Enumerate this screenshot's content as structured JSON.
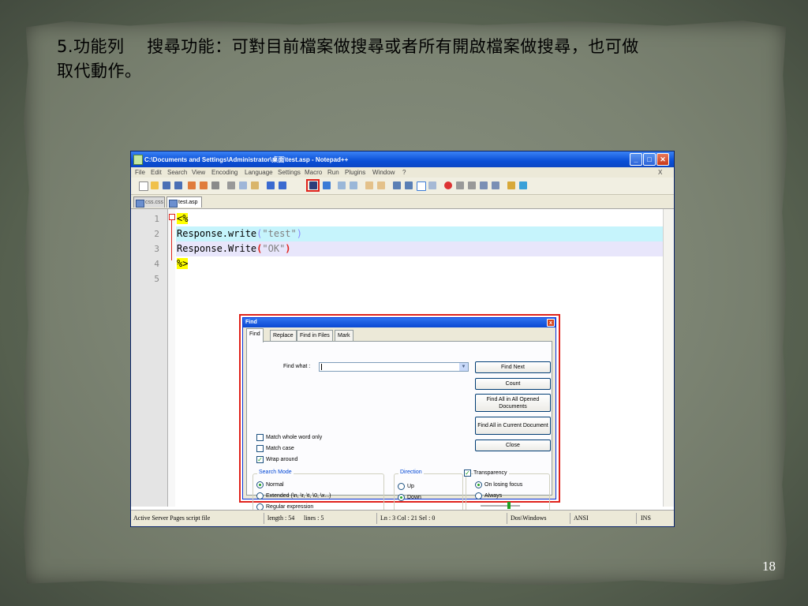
{
  "slide": {
    "title_line1": "5.功能列 　搜尋功能：可對目前檔案做搜尋或者所有開啟檔案做搜尋，也可做",
    "title_line2": "取代動作。",
    "page_number": "18"
  },
  "app": {
    "window_title": "C:\\Documents and Settings\\Administrator\\桌面\\test.asp - Notepad++",
    "menu": [
      "File",
      "Edit",
      "Search",
      "View",
      "Encoding",
      "Language",
      "Settings",
      "Macro",
      "Run",
      "Plugins",
      "Window",
      "?"
    ],
    "menu_close": "X",
    "tabs": [
      "css.css",
      "test.asp"
    ],
    "line_numbers": [
      "1",
      "2",
      "3",
      "4",
      "5"
    ],
    "code": {
      "l1": "<%",
      "l2_obj": "Response.write",
      "l2_paren_open": "(",
      "l2_str": "\"test\"",
      "l2_paren_close": ")",
      "l3_obj": "Response.Write",
      "l3_paren_open": "(",
      "l3_str": "\"OK\"",
      "l3_paren_close": ")",
      "l4": "%>"
    },
    "status": {
      "file_type": "Active Server Pages script file",
      "length": "length : 54",
      "lines": "lines : 5",
      "position": "Ln : 3    Col : 21    Sel : 0",
      "eol": "Dos\\Windows",
      "encoding": "ANSI",
      "mode": "INS"
    }
  },
  "find_dialog": {
    "title": "Find",
    "close": "x",
    "tabs": [
      "Find",
      "Replace",
      "Find in Files",
      "Mark"
    ],
    "find_what_label": "Find what :",
    "find_what_value": "",
    "buttons": {
      "find_next": "Find Next",
      "count": "Count",
      "find_all_opened": "Find All in All Opened Documents",
      "find_all_current": "Find All in Current Document",
      "close": "Close"
    },
    "checkboxes": {
      "match_whole_word": "Match whole word only",
      "match_case": "Match case",
      "wrap_around": "Wrap around"
    },
    "search_mode": {
      "title": "Search Mode",
      "normal": "Normal",
      "extended": "Extended (\\n, \\r, \\t, \\0, \\x...)",
      "regex": "Regular expression"
    },
    "direction": {
      "title": "Direction",
      "up": "Up",
      "down": "Down"
    },
    "transparency": {
      "title": "Transparency",
      "on_losing_focus": "On losing focus",
      "always": "Always"
    }
  }
}
